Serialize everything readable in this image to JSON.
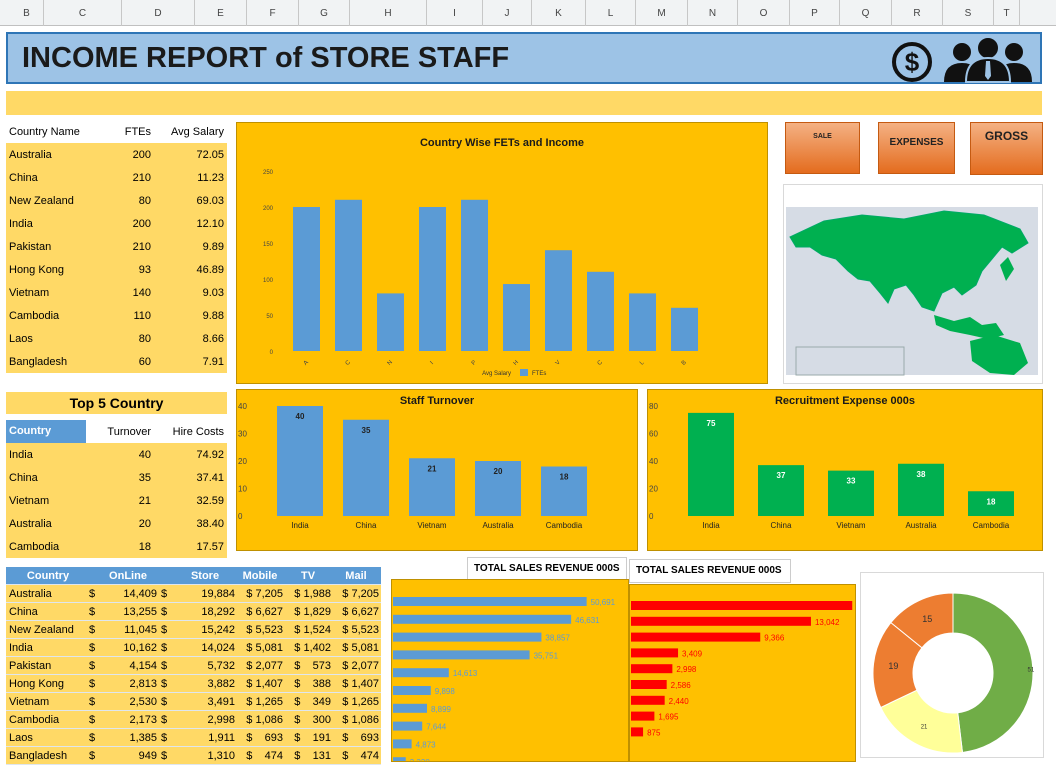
{
  "columns": [
    "B",
    "C",
    "D",
    "E",
    "F",
    "G",
    "H",
    "I",
    "J",
    "K",
    "L",
    "M",
    "N",
    "O",
    "P",
    "Q",
    "R",
    "S",
    "T"
  ],
  "title": "INCOME REPORT of STORE STAFF",
  "colors": {
    "gold": "#ffc000",
    "blue": "#5b9bd5",
    "green": "#00b050",
    "red": "#ff0000",
    "yellow": "#ffd966"
  },
  "country_table": {
    "headers": [
      "Country Name",
      "FTEs",
      "Avg Salary"
    ],
    "rows": [
      [
        "Australia",
        "200",
        "72.05"
      ],
      [
        "China",
        "210",
        "11.23"
      ],
      [
        "New Zealand",
        "80",
        "69.03"
      ],
      [
        "India",
        "200",
        "12.10"
      ],
      [
        "Pakistan",
        "210",
        "9.89"
      ],
      [
        "Hong Kong",
        "93",
        "46.89"
      ],
      [
        "Vietnam",
        "140",
        "9.03"
      ],
      [
        "Cambodia",
        "110",
        "9.88"
      ],
      [
        "Laos",
        "80",
        "8.66"
      ],
      [
        "Bangladesh",
        "60",
        "7.91"
      ]
    ]
  },
  "top5": {
    "title": "Top 5 Country",
    "headers": [
      "Country",
      "Turnover",
      "Hire Costs"
    ],
    "rows": [
      [
        "India",
        "40",
        "74.92"
      ],
      [
        "China",
        "35",
        "37.41"
      ],
      [
        "Vietnam",
        "21",
        "32.59"
      ],
      [
        "Australia",
        "20",
        "38.40"
      ],
      [
        "Cambodia",
        "18",
        "17.57"
      ]
    ]
  },
  "buttons": {
    "sale": "SALE",
    "expenses": "EXPENSES",
    "gross": "GROSS"
  },
  "chart_data": [
    {
      "type": "bar",
      "title": "Country Wise FETs and Income",
      "categories": [
        "A",
        "C",
        "N",
        "I",
        "P",
        "H",
        "V",
        "C",
        "L",
        "B"
      ],
      "series": [
        {
          "name": "Avg Salary",
          "values": [
            72.05,
            11.23,
            69.03,
            12.1,
            9.89,
            46.89,
            9.03,
            9.88,
            8.66,
            7.91
          ]
        },
        {
          "name": "FTEs",
          "values": [
            200,
            210,
            80,
            200,
            210,
            93,
            140,
            110,
            80,
            60
          ]
        }
      ],
      "ylim": [
        0,
        250
      ],
      "yticks": [
        "0",
        "50",
        "100",
        "150",
        "200",
        "250"
      ]
    },
    {
      "type": "bar",
      "title": "Staff Turnover",
      "categories": [
        "India",
        "China",
        "Vietnam",
        "Australia",
        "Cambodia"
      ],
      "values": [
        40,
        35,
        21,
        20,
        18
      ],
      "ylim": [
        0,
        40
      ],
      "yticks": [
        "0",
        "10",
        "20",
        "30",
        "40"
      ]
    },
    {
      "type": "bar",
      "title": "Recruitment Expense 000s",
      "categories": [
        "India",
        "China",
        "Vietnam",
        "Australia",
        "Cambodia"
      ],
      "values": [
        75,
        37,
        33,
        38,
        18
      ],
      "ylim": [
        0,
        80
      ],
      "yticks": [
        "0",
        "20",
        "40",
        "60",
        "80"
      ]
    },
    {
      "type": "bar",
      "title": "TOTAL SALES REVENUE 000S",
      "values": [
        50691,
        46631,
        38857,
        35751,
        14613,
        9898,
        8899,
        7644,
        4873,
        3338
      ],
      "labels": [
        "50,691",
        "46,631",
        "38,857",
        "35,751",
        "14,613",
        "9,898",
        "8,899",
        "7,644",
        "4,873",
        "3,338"
      ]
    },
    {
      "type": "bar",
      "title": "TOTAL SALES REVENUE 000S",
      "values": [
        16033,
        13042,
        9366,
        3409,
        2998,
        2586,
        2440,
        1695,
        875
      ],
      "labels": [
        "16,033",
        "13,042",
        "9,366",
        "3,409",
        "2,998",
        "2,586",
        "2,440",
        "1,695",
        "875"
      ]
    },
    {
      "type": "pie",
      "values": [
        51,
        21,
        19,
        15
      ],
      "labels": [
        "51",
        "21",
        "19",
        "15"
      ],
      "colors": [
        "#70ad47",
        "#ffff99",
        "#ed7d31",
        "#ed7d31"
      ]
    }
  ],
  "bottom_table": {
    "headers": [
      "Country",
      "OnLine",
      "Store",
      "Mobile",
      "TV",
      "Mail"
    ],
    "rows": [
      [
        "Australia",
        "$",
        "14,409",
        "$",
        "19,884",
        "$ 7,205",
        "$ 1,988",
        "$ 7,205"
      ],
      [
        "China",
        "$",
        "13,255",
        "$",
        "18,292",
        "$ 6,627",
        "$ 1,829",
        "$ 6,627"
      ],
      [
        "New Zealand",
        "$",
        "11,045",
        "$",
        "15,242",
        "$ 5,523",
        "$ 1,524",
        "$ 5,523"
      ],
      [
        "India",
        "$",
        "10,162",
        "$",
        "14,024",
        "$ 5,081",
        "$ 1,402",
        "$ 5,081"
      ],
      [
        "Pakistan",
        "$",
        "4,154",
        "$",
        "5,732",
        "$ 2,077",
        "$    573",
        "$ 2,077"
      ],
      [
        "Hong Kong",
        "$",
        "2,813",
        "$",
        "3,882",
        "$ 1,407",
        "$    388",
        "$ 1,407"
      ],
      [
        "Vietnam",
        "$",
        "2,530",
        "$",
        "3,491",
        "$ 1,265",
        "$    349",
        "$ 1,265"
      ],
      [
        "Cambodia",
        "$",
        "2,173",
        "$",
        "2,998",
        "$ 1,086",
        "$    300",
        "$ 1,086"
      ],
      [
        "Laos",
        "$",
        "1,385",
        "$",
        "1,911",
        "$    693",
        "$    191",
        "$    693"
      ],
      [
        "Bangladesh",
        "$",
        "949",
        "$",
        "1,310",
        "$    474",
        "$    131",
        "$    474"
      ]
    ]
  }
}
